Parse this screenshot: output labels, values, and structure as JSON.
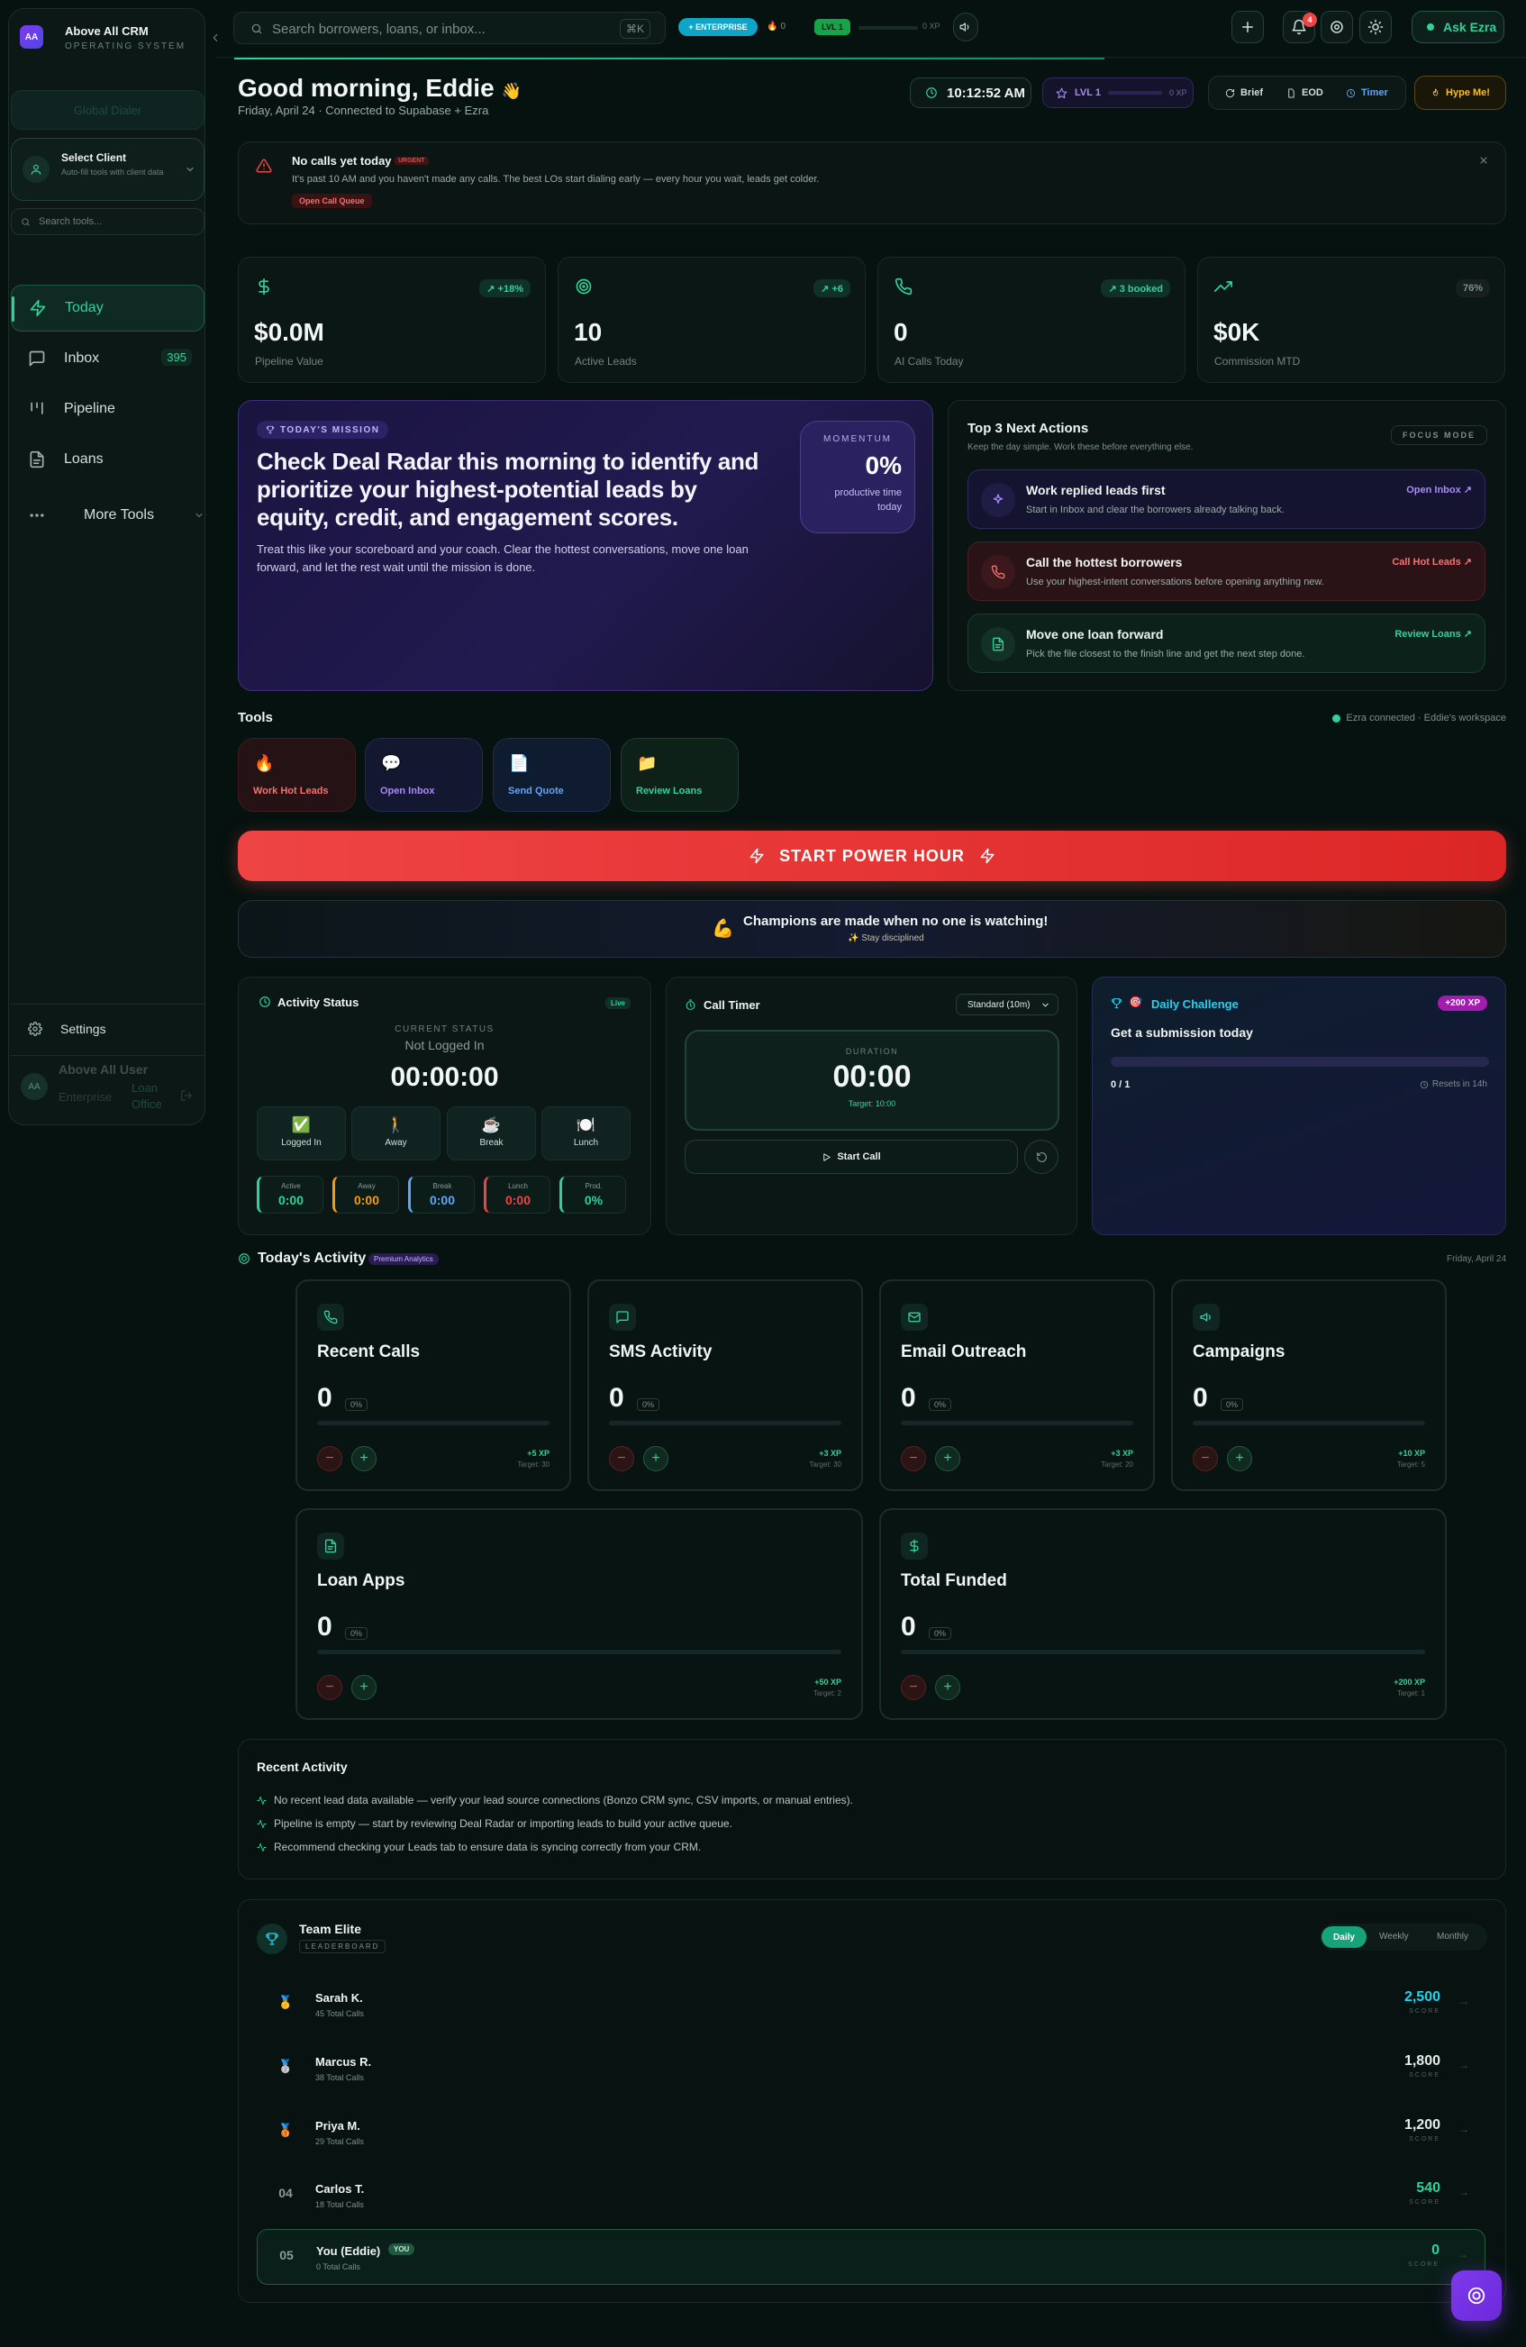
{
  "app": {
    "name": "Above All CRM",
    "subtitle": "OPERATING SYSTEM",
    "logo_initials": "AA",
    "sidebar_button": "Global Dialer"
  },
  "client": {
    "title": "Select Client",
    "desc": "Auto-fill tools with client data"
  },
  "sidebar": {
    "search_placeholder": "Search tools...",
    "items": [
      {
        "label": "Today",
        "icon": "bolt-icon"
      },
      {
        "label": "Inbox",
        "badge": "395",
        "icon": "chat-icon"
      },
      {
        "label": "Pipeline",
        "icon": "pipeline-icon"
      },
      {
        "label": "Loans",
        "icon": "document-icon"
      },
      {
        "label": "More Tools",
        "icon": "dots-icon"
      }
    ],
    "settings": "Settings",
    "user": {
      "name": "Above All User",
      "initials": "AA",
      "org": "Enterprise",
      "location": "Loan Office"
    }
  },
  "topbar": {
    "search_placeholder": "Search borrowers, loans, or inbox...",
    "shortcut": "⌘K",
    "plan": "+ ENTERPRISE",
    "streak": "0",
    "level": "LVL 1",
    "xp": "0 XP",
    "notifications": "4",
    "ask": "Ask Ezra"
  },
  "header": {
    "greeting": "Good morning, Eddie",
    "greeting_emoji": "👋",
    "subline": "Friday, April 24 · Connected to Supabase + Ezra",
    "clock": "10:12:52 AM",
    "level": "LVL 1",
    "xp": "0 XP",
    "actions": [
      "Brief",
      "EOD",
      "Timer"
    ],
    "hype": "Hype Me!"
  },
  "alert": {
    "title": "No calls yet today",
    "tag": "URGENT",
    "message": "It's past 10 AM and you haven't made any calls. The best LOs start dialing early — every hour you wait, leads get colder.",
    "button": "Open Call Queue"
  },
  "stats": [
    {
      "value": "$0.0M",
      "label": "Pipeline Value",
      "badge": "↗ +18%",
      "icon": "dollar-icon"
    },
    {
      "value": "10",
      "label": "Active Leads",
      "badge": "↗ +6",
      "icon": "target-icon"
    },
    {
      "value": "0",
      "label": "AI Calls Today",
      "badge": "↗ 3 booked",
      "icon": "phone-icon"
    },
    {
      "value": "$0K",
      "label": "Commission MTD",
      "badge": "76%",
      "icon": "trend-icon"
    }
  ],
  "mission": {
    "tag": "TODAY'S MISSION",
    "title": "Check Deal Radar this morning to identify and prioritize your highest-potential leads by equity, credit, and engagement scores.",
    "body": "Treat this like your scoreboard and your coach. Clear the hottest conversations, move one loan forward, and let the rest wait until the mission is done.",
    "momentum_label": "MOMENTUM",
    "momentum_value": "0%",
    "momentum_desc": "productive time today"
  },
  "next_actions": {
    "title": "Top 3 Next Actions",
    "subtitle": "Keep the day simple. Work these before everything else.",
    "focus": "FOCUS MODE",
    "items": [
      {
        "title": "Work replied leads first",
        "desc": "Start in Inbox and clear the borrowers already talking back.",
        "link": "Open Inbox ↗",
        "color": "#a78bfa",
        "icon": "sparkle-icon"
      },
      {
        "title": "Call the hottest borrowers",
        "desc": "Use your highest-intent conversations before opening anything new.",
        "link": "Call Hot Leads ↗",
        "color": "#f87171",
        "icon": "phone-icon"
      },
      {
        "title": "Move one loan forward",
        "desc": "Pick the file closest to the finish line and get the next step done.",
        "link": "Review Loans ↗",
        "color": "#34d399",
        "icon": "document-icon"
      }
    ]
  },
  "tools": {
    "title": "Tools",
    "status": "Ezra connected · Eddie's workspace",
    "items": [
      {
        "label": "Work Hot Leads",
        "emoji": "🔥",
        "color": "#f87171"
      },
      {
        "label": "Open Inbox",
        "emoji": "💬",
        "color": "#a78bfa"
      },
      {
        "label": "Send Quote",
        "emoji": "📄",
        "color": "#60a5fa"
      },
      {
        "label": "Review Loans",
        "emoji": "📁",
        "color": "#34d399"
      }
    ]
  },
  "power_hour": "START POWER HOUR",
  "champion": {
    "emoji": "💪",
    "text": "Champions are made when no one is watching!",
    "sub": "✨ Stay disciplined"
  },
  "activity_status": {
    "title": "Activity Status",
    "live": "Live",
    "current_label": "CURRENT STATUS",
    "current": "Not Logged In",
    "timer": "00:00:00",
    "buttons": [
      {
        "label": "Logged In",
        "emoji": "✅"
      },
      {
        "label": "Away",
        "emoji": "🚶"
      },
      {
        "label": "Break",
        "emoji": "☕"
      },
      {
        "label": "Lunch",
        "emoji": "🍽️"
      }
    ],
    "minis": [
      {
        "label": "Active",
        "value": "0:00",
        "color": "#2fd39a"
      },
      {
        "label": "Away",
        "value": "0:00",
        "color": "#f59e0b"
      },
      {
        "label": "Break",
        "value": "0:00",
        "color": "#60a5fa"
      },
      {
        "label": "Lunch",
        "value": "0:00",
        "color": "#ef4444"
      },
      {
        "label": "Prod.",
        "value": "0%",
        "color": "#2fd39a"
      }
    ]
  },
  "call_timer": {
    "title": "Call Timer",
    "mode": "Standard (10m)",
    "duration_label": "DURATION",
    "time": "00:00",
    "target": "Target: 10:00",
    "start": "Start Call"
  },
  "challenge": {
    "title": "Daily Challenge",
    "xp": "+200 XP",
    "task": "Get a submission today",
    "progress": "0 / 1",
    "progress_fraction": 0,
    "resets": "Resets in 14h"
  },
  "today_activity": {
    "title": "Today's Activity",
    "tag": "Premium Analytics",
    "date": "Friday, April 24",
    "metrics": [
      {
        "title": "Recent Calls",
        "value": "0",
        "pct": "0%",
        "xp": "+5 XP",
        "target": "Target: 30",
        "icon": "phone-icon"
      },
      {
        "title": "SMS Activity",
        "value": "0",
        "pct": "0%",
        "xp": "+3 XP",
        "target": "Target: 30",
        "icon": "chat-icon"
      },
      {
        "title": "Email Outreach",
        "value": "0",
        "pct": "0%",
        "xp": "+3 XP",
        "target": "Target: 20",
        "icon": "mail-icon"
      },
      {
        "title": "Campaigns",
        "value": "0",
        "pct": "0%",
        "xp": "+10 XP",
        "target": "Target: 5",
        "icon": "megaphone-icon"
      },
      {
        "title": "Loan Apps",
        "value": "0",
        "pct": "0%",
        "xp": "+50 XP",
        "target": "Target: 2",
        "icon": "document-icon"
      },
      {
        "title": "Total Funded",
        "value": "0",
        "pct": "0%",
        "xp": "+200 XP",
        "target": "Target: 1",
        "icon": "dollar-icon"
      }
    ]
  },
  "recent_activity": {
    "title": "Recent Activity",
    "items": [
      "No recent lead data available — verify your lead source connections (Bonzo CRM sync, CSV imports, or manual entries).",
      "Pipeline is empty — start by reviewing Deal Radar or importing leads to build your active queue.",
      "Recommend checking your Leads tab to ensure data is syncing correctly from your CRM."
    ]
  },
  "leaderboard": {
    "title": "Team Elite",
    "subtitle": "LEADERBOARD",
    "tabs": [
      "Daily",
      "Weekly",
      "Monthly"
    ],
    "score_label": "SCORE",
    "you_tag": "YOU",
    "rows": [
      {
        "rank": "🥇",
        "name": "Sarah K.",
        "calls": "45 Total Calls",
        "score": "2,500",
        "color": "#22d3ee"
      },
      {
        "rank": "🥈",
        "name": "Marcus R.",
        "calls": "38 Total Calls",
        "score": "1,800",
        "color": "#e7eeea"
      },
      {
        "rank": "🥉",
        "name": "Priya M.",
        "calls": "29 Total Calls",
        "score": "1,200",
        "color": "#e7eeea"
      },
      {
        "rank": "04",
        "name": "Carlos T.",
        "calls": "18 Total Calls",
        "score": "540",
        "color": "#2fd39a"
      },
      {
        "rank": "05",
        "name": "You (Eddie)",
        "calls": "0 Total Calls",
        "score": "0",
        "color": "#2fd39a"
      }
    ]
  }
}
